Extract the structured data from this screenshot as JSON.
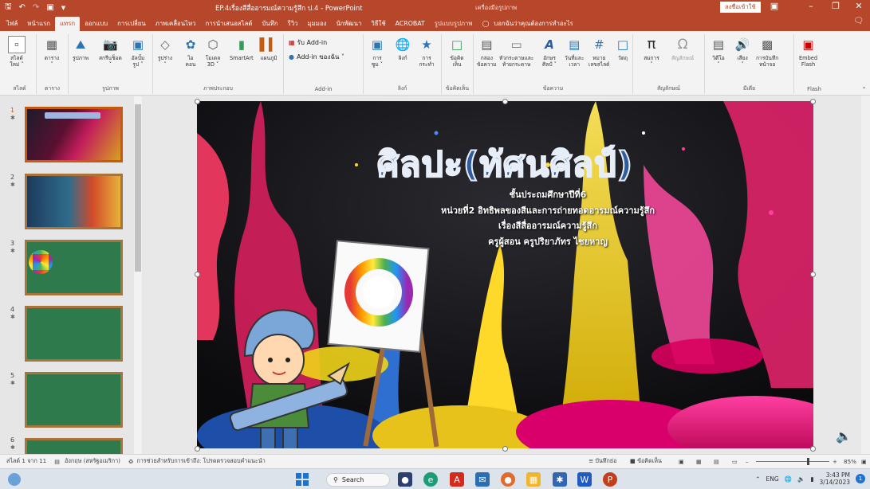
{
  "app": {
    "title": "EP.4เรื่องสีสื่ออารมณ์ความรู้สึก ป.4  -  PowerPoint",
    "context_group": "เครื่องมือรูปภาพ",
    "signin": "ลงชื่อเข้าใช้"
  },
  "tabs": [
    "ไฟล์",
    "หน้าแรก",
    "แทรก",
    "ออกแบบ",
    "การเปลี่ยน",
    "ภาพเคลื่อนไหว",
    "การนำเสนอสไลด์",
    "บันทึก",
    "รีวิว",
    "มุมมอง",
    "นักพัฒนา",
    "วิธีใช้",
    "ACROBAT",
    "รูปแบบรูปภาพ"
  ],
  "active_tab": "แทรก",
  "tellme": "บอกฉันว่าคุณต้องการทำอะไร",
  "ribbon": {
    "groups": [
      "สไลด์",
      "ตาราง",
      "รูปภาพ",
      "ภาพประกอบ",
      "Add-in",
      "ลิงก์",
      "ข้อคิดเห็น",
      "ข้อความ",
      "สัญลักษณ์",
      "มีเดีย",
      "Flash"
    ],
    "slides": [
      {
        "label": "สไลด์\nใหม่ ˅"
      }
    ],
    "table": [
      {
        "label": "ตาราง\n˅"
      }
    ],
    "images": [
      {
        "label": "รูปภาพ"
      },
      {
        "label": "สกรีนช็อต\n˅"
      },
      {
        "label": "อัลบั้ม\nรูป ˅"
      }
    ],
    "illus": [
      {
        "label": "รูปร่าง\n˅"
      },
      {
        "label": "ไอ\nคอน"
      },
      {
        "label": "โมเดล\n3D ˅"
      },
      {
        "label": "SmartArt"
      },
      {
        "label": "แผนภูมิ"
      }
    ],
    "addin": {
      "get": "รับ Add-in",
      "mine": "Add-in ของฉัน  ˅"
    },
    "links": [
      {
        "label": "การ\nซูม ˅"
      },
      {
        "label": "ลิงก์"
      },
      {
        "label": "การ\nกระทำ"
      }
    ],
    "comments": [
      {
        "label": "ข้อคิด\nเห็น"
      }
    ],
    "text": [
      {
        "label": "กล่อง\nข้อความ"
      },
      {
        "label": "หัวกระดาษและ\nท้ายกระดาษ"
      },
      {
        "label": "อักษร\nศิลป์ ˅"
      },
      {
        "label": "วันที่และ\nเวลา"
      },
      {
        "label": "หมาย\nเลขสไลด์"
      },
      {
        "label": "วัตถุ"
      }
    ],
    "symbols": [
      {
        "label": "สมการ\n˅"
      },
      {
        "label": "สัญลักษณ์"
      }
    ],
    "media": [
      {
        "label": "วิดีโอ\n˅"
      },
      {
        "label": "เสียง\n˅"
      },
      {
        "label": "การบันทึก\nหน้าจอ"
      }
    ],
    "flash": [
      {
        "label": "Embed\nFlash"
      }
    ]
  },
  "thumbnails": [
    {
      "n": "1"
    },
    {
      "n": "2"
    },
    {
      "n": "3"
    },
    {
      "n": "4"
    },
    {
      "n": "5"
    },
    {
      "n": "6"
    }
  ],
  "slide": {
    "title": "ศิลปะ(ทัศนศิลป์)",
    "lines": [
      "ชั้นประถมศึกษาปีที่6",
      "หน่วยที่2 อิทธิพลของสีและการถ่ายทอดอารมณ์ความรู้สึก",
      "เรื่องสีสื่ออารมณ์ความรู้สึก",
      "ครูผู้สอน ครูปริยาภัทร ไชยหาญ"
    ]
  },
  "status": {
    "slide": "สไลด์ 1 จาก 11",
    "lang": "อังกฤษ (สหรัฐอเมริกา)",
    "access": "การช่วยสำหรับการเข้าถึง: โปรดตรวจสอบคำแนะนำ",
    "notes": "บันทึกย่อ",
    "comments": "ข้อคิดเห็น",
    "zoom": "85%"
  },
  "taskbar": {
    "search": "Search",
    "lang": "ENG",
    "time": "3:43 PM",
    "date": "3/14/2023"
  }
}
